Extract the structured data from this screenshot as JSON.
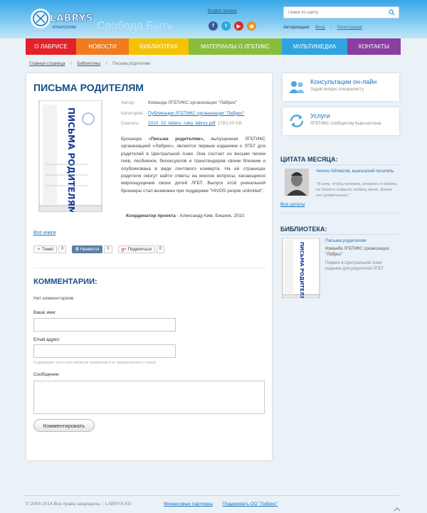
{
  "header": {
    "logo_text": "LABRYS",
    "logo_sub": "KYRGYZSTAN",
    "tagline": "Свобода Быть",
    "english_link": "English version",
    "socials": [
      {
        "icon": "facebook-icon",
        "glyph": "f",
        "color": "#3b5998"
      },
      {
        "icon": "twitter-icon",
        "glyph": "t",
        "color": "#29a9e1"
      },
      {
        "icon": "youtube-icon",
        "glyph": "▶",
        "color": "#d52b2b"
      },
      {
        "icon": "rss-icon",
        "glyph": "◉",
        "color": "#f28c1a"
      }
    ],
    "search_placeholder": "Поиск по сайту",
    "auth_label": "Авторизация:",
    "login": "Вход",
    "register": "Регистрация"
  },
  "nav": {
    "items": [
      {
        "label": "О Лабрисе",
        "color": "#e4212b",
        "width": 71
      },
      {
        "label": "Новости",
        "color": "#f07b20",
        "width": 74
      },
      {
        "label": "Библиотека",
        "color": "#f5c200",
        "width": 84
      },
      {
        "label": "Материалы о ЛГБТИКС",
        "color": "#86be3c",
        "width": 131
      },
      {
        "label": "Мультимедиа",
        "color": "#2fa4e0",
        "width": 92
      },
      {
        "label": "Контакты",
        "color": "#8b3ea0",
        "width": 75
      }
    ]
  },
  "breadcrumb": [
    "Главная страница",
    "Библиотека",
    "Письма родителям"
  ],
  "article": {
    "title": "ПИСЬМА РОДИТЕЛЯМ",
    "book_cover_text": "ПИСЬМА РОДИТЕЛЯМ",
    "meta": [
      {
        "label": "Автор:",
        "value": "Команда ЛГБТИКС организации \"Лабрис\"",
        "link": false
      },
      {
        "label": "Категория:",
        "value": "Публикации ЛГБТИКС организации \"Лабрис\"",
        "link": true
      },
      {
        "label": "Скачать:",
        "value": "2010_02_letters_rukg_labrys.pdf",
        "size": "1783.00 KB",
        "link": true
      }
    ],
    "desc_bold": "Письма родителям»,",
    "desc_prefix": "Брошюра «",
    "desc_rest": " выпущенная ЛГБТИКС организацией «Лабрис», является первым изданием о ЛГБТ для родителей в Центральной Азии. Она состоит из восьми писем геев, лесбиянок, бисексуалов и трансгендеров своим близким и опубликована в виде почтового конверта. На её страницах родители смогут найти ответы на многие вопросы, касающиеся мироощущения своих детей ЛГБТ. Выпуск этой уникальной брошюры стал возможен при поддержке \"HIVOS people unlimited\".",
    "coord_bold": "Координатор проекта",
    "coord_rest": " - Александр Ким. Бишкек, 2010.",
    "all_books": "Все книги",
    "shares": [
      {
        "icon": "twitter-bird-icon",
        "label": "Tweet",
        "count": "0"
      },
      {
        "icon": "vk-icon",
        "label": "Нравится",
        "count": "0"
      },
      {
        "icon": "google-plus-icon",
        "label": "Поделиться",
        "count": "0"
      }
    ]
  },
  "comments": {
    "title": "КОММЕНТАРИИ:",
    "empty": "Нет комментариев",
    "name_label": "Ваше имя:",
    "email_label": "Email адрес:",
    "email_note": "Содержание этого поля является приватным и не предназначено к показу",
    "message_label": "Сообщение:",
    "submit": "Комментировать"
  },
  "sidebar": {
    "cards": [
      {
        "title": "Консультации он-лайн",
        "sub": "Задай вопрос специалисту"
      },
      {
        "title": "Услуги",
        "sub": "ЛГБТИКС сообществу Кыргызстана"
      }
    ],
    "quote_heading": "ЦИТАТА МЕСЯЦА:",
    "quote_author": "Чингиз Айтматов, кыргызский писатель",
    "quote_text": "\"Я хочу, чтобы человек, которого я люблю, не боялся открыто любить меня. Иначе это унизительно.\"",
    "all_quotes": "Все цитаты",
    "library_heading": "БИБЛИОТЕКА:",
    "lib_title": "Письма родителям",
    "lib_author": "Команда ЛГБТИКС организации \"Лабрис\"",
    "lib_desc": "Первое в Центральной Азии издание для родителей ЛГБТ"
  },
  "footer": {
    "copyright": "© 2004-2014 Все права защищены :: LABRYS.KG",
    "links": [
      "Финансовые партнеры",
      "Поддержать ОО \"Лабрис\""
    ]
  }
}
